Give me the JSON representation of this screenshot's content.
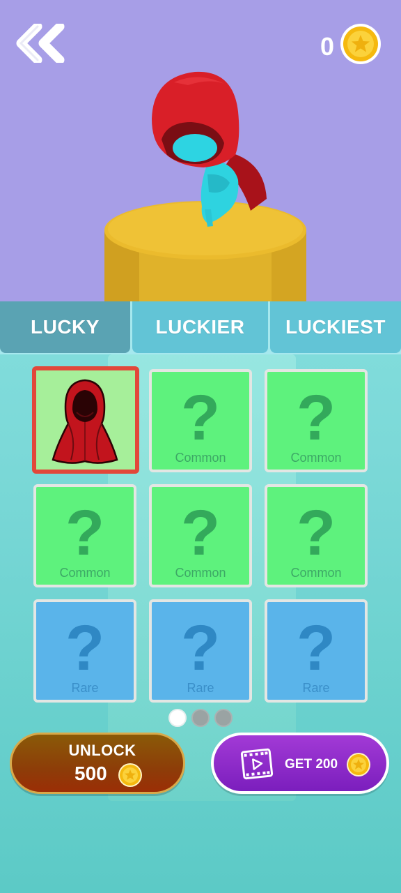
{
  "header": {
    "coins": "0"
  },
  "tabs": [
    {
      "label": "LUCKY",
      "active": true
    },
    {
      "label": "LUCKIER",
      "active": false
    },
    {
      "label": "LUCKIEST",
      "active": false
    }
  ],
  "grid": {
    "cards": [
      {
        "rarity": "selected",
        "label": "",
        "item_icon": "red-hood-cloak-icon"
      },
      {
        "rarity": "common",
        "label": "Common"
      },
      {
        "rarity": "common",
        "label": "Common"
      },
      {
        "rarity": "common",
        "label": "Common"
      },
      {
        "rarity": "common",
        "label": "Common"
      },
      {
        "rarity": "common",
        "label": "Common"
      },
      {
        "rarity": "rare",
        "label": "Rare"
      },
      {
        "rarity": "rare",
        "label": "Rare"
      },
      {
        "rarity": "rare",
        "label": "Rare"
      }
    ],
    "mystery_glyph": "?"
  },
  "pager": {
    "pages": 3,
    "current": 1
  },
  "unlock": {
    "label": "UNLOCK",
    "price": "500"
  },
  "ad": {
    "label": "GET 200",
    "icon": "film-play-icon"
  },
  "colors": {
    "sky": "#a79ee7",
    "common": "#5ef27d",
    "rare": "#5ab4ea",
    "selected_border": "#e2473a",
    "unlock_button": "#8d3d08",
    "ad_button": "#8a2bcb",
    "coin": "#f7c21d"
  }
}
